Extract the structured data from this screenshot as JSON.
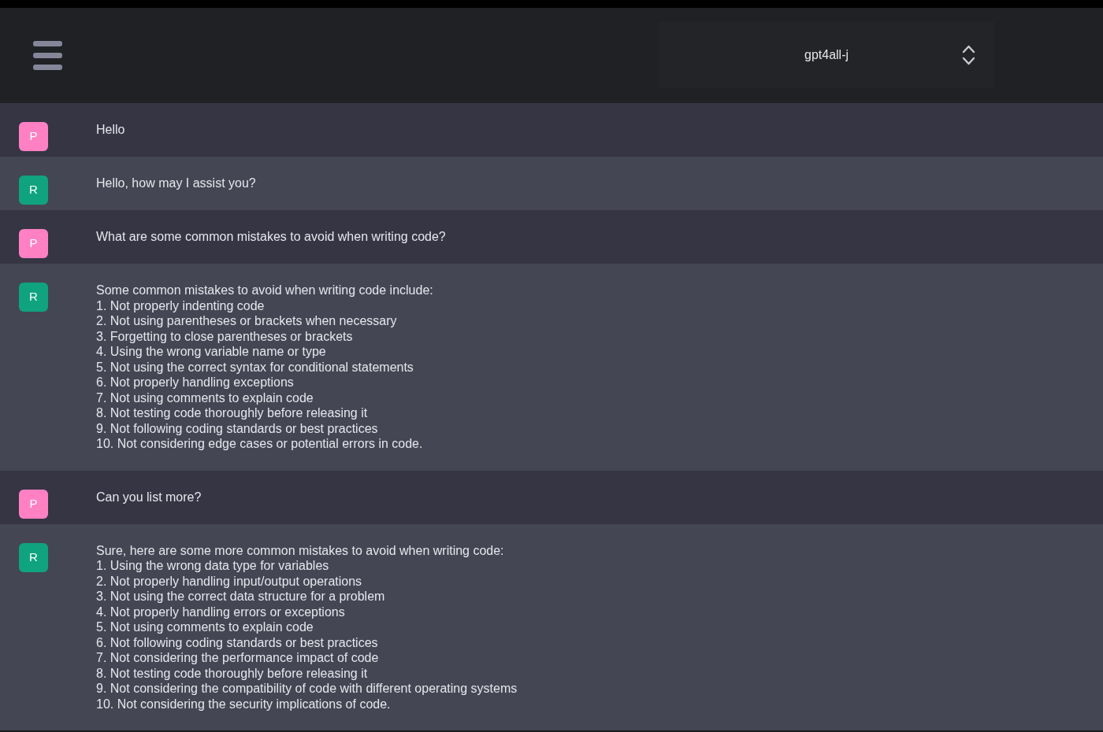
{
  "header": {
    "model_select": {
      "value": "gpt4all-j"
    }
  },
  "messages": [
    {
      "kind": "prompt",
      "avatar": "P",
      "text": "Hello"
    },
    {
      "kind": "response",
      "avatar": "R",
      "text": "Hello, how may I assist you?"
    },
    {
      "kind": "prompt",
      "avatar": "P",
      "text": "What are some common mistakes to avoid when writing code?"
    },
    {
      "kind": "response",
      "avatar": "R",
      "text": "Some common mistakes to avoid when writing code include:\n1. Not properly indenting code\n2. Not using parentheses or brackets when necessary\n3. Forgetting to close parentheses or brackets\n4. Using the wrong variable name or type\n5. Not using the correct syntax for conditional statements\n6. Not properly handling exceptions\n7. Not using comments to explain code\n8. Not testing code thoroughly before releasing it\n9. Not following coding standards or best practices\n10. Not considering edge cases or potential errors in code."
    },
    {
      "kind": "prompt",
      "avatar": "P",
      "text": "Can you list more?"
    },
    {
      "kind": "response",
      "avatar": "R",
      "text": "Sure, here are some more common mistakes to avoid when writing code:\n1. Using the wrong data type for variables\n2. Not properly handling input/output operations\n3. Not using the correct data structure for a problem\n4. Not properly handling errors or exceptions\n5. Not using comments to explain code\n6. Not following coding standards or best practices\n7. Not considering the performance impact of code\n8. Not testing code thoroughly before releasing it\n9. Not considering the compatibility of code with different operating systems\n10. Not considering the security implications of code."
    }
  ]
}
